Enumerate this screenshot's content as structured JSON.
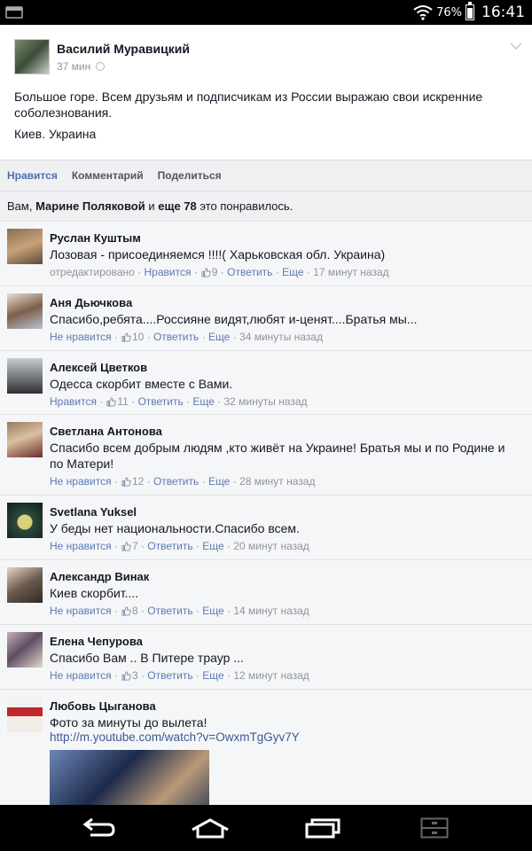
{
  "status_bar": {
    "battery": "76%",
    "time": "16:41"
  },
  "post": {
    "author": "Василий Муравицкий",
    "time": "37 мин",
    "text": "Большое горе. Всем друзьям и подписчикам из России выражаю свои искренние соболезнования.",
    "place": "Киев. Украина"
  },
  "actions": {
    "like": "Нравится",
    "comment": "Комментарий",
    "share": "Поделиться"
  },
  "likes_summary": {
    "prefix": "Вам, ",
    "name": "Марине Поляковой",
    "middle": " и ",
    "more": "еще 78",
    "suffix": " это понравилось."
  },
  "comments": [
    {
      "name": "Руслан Куштым",
      "text": "Лозовая - присоединяемся !!!!( Харьковская обл. Украина)",
      "edited": "отредактировано",
      "like_action": "Нравится",
      "likes": "9",
      "reply": "Ответить",
      "more": "Еще",
      "time": "17 минут назад"
    },
    {
      "name": "Аня Дьючкова",
      "text": "Спасибо,ребята....Россияне видят,любят и-ценят....Братья мы...",
      "like_action": "Не нравится",
      "likes": "10",
      "reply": "Ответить",
      "more": "Еще",
      "time": "34 минуты назад"
    },
    {
      "name": "Алексей Цветков",
      "text": "Одесса скорбит вместе с Вами.",
      "like_action": "Нравится",
      "likes": "11",
      "reply": "Ответить",
      "more": "Еще",
      "time": "32 минуты назад"
    },
    {
      "name": "Светлана Антонова",
      "text": "Спасибо всем добрым людям ,кто живёт на Украине! Братья мы и по Родине и по Матери!",
      "like_action": "Не нравится",
      "likes": "12",
      "reply": "Ответить",
      "more": "Еще",
      "time": "28 минут назад"
    },
    {
      "name": "Svetlana Yuksel",
      "text": "У беды нет национальности.Спасибо всем.",
      "like_action": "Не нравится",
      "likes": "7",
      "reply": "Ответить",
      "more": "Еще",
      "time": "20 минут назад"
    },
    {
      "name": "Александр Винак",
      "text": "Киев скорбит....",
      "like_action": "Не нравится",
      "likes": "8",
      "reply": "Ответить",
      "more": "Еще",
      "time": "14 минут назад"
    },
    {
      "name": "Елена Чепурова",
      "text": "Спасибо Вам .. В Питере траур ...",
      "like_action": "Не нравится",
      "likes": "3",
      "reply": "Ответить",
      "more": "Еще",
      "time": "12 минут назад"
    },
    {
      "name": "Любовь Цыганова",
      "text": "Фото за минуты до вылета!",
      "link": "http://m.youtube.com/watch?v=OwxmTgGyv7Y"
    }
  ],
  "colors": {
    "link": "#3b5998",
    "meta": "#90949c",
    "action_blue": "#4b6fb1"
  },
  "icons": {
    "wifi": "wifi-icon",
    "battery": "battery-icon",
    "back": "back-icon",
    "home": "home-icon",
    "recents": "recents-icon",
    "menu": "menu-icon",
    "like": "thumb-up-icon",
    "globe": "globe-icon",
    "chevron": "chevron-down-icon"
  }
}
